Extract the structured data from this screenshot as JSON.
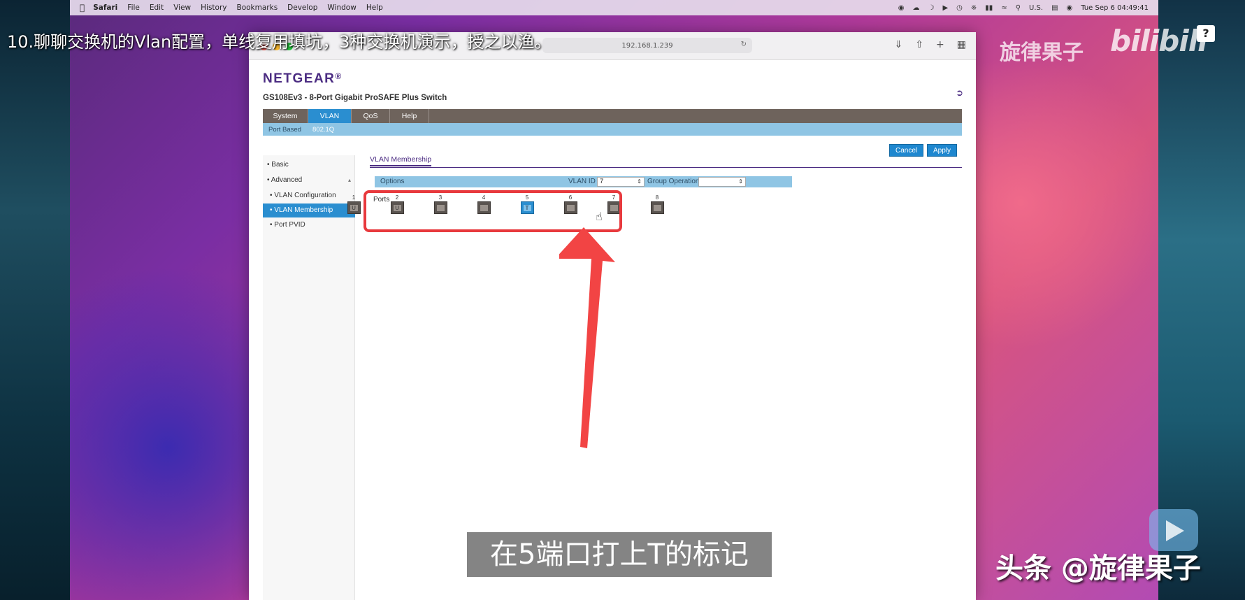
{
  "overlay": {
    "video_title": "10.聊聊交换机的Vlan配置，单线复用填坑，3种交换机演示，授之以渔。",
    "bili_channel": "旋律果子",
    "bili_logo": "bilibili",
    "help_badge": "?",
    "subtitle": "在5端口打上T的标记",
    "watermark": "头条 @旋律果子"
  },
  "menubar": {
    "items": [
      "Safari",
      "File",
      "Edit",
      "View",
      "History",
      "Bookmarks",
      "Develop",
      "Window",
      "Help"
    ],
    "input_source": "U.S.",
    "datetime": "Tue Sep 6  04:49:41"
  },
  "browser": {
    "address": "192.168.1.239"
  },
  "netgear": {
    "logo": "NETGEAR",
    "model": "GS108Ev3 - 8-Port Gigabit ProSAFE Plus Switch",
    "tabs": [
      "System",
      "VLAN",
      "QoS",
      "Help"
    ],
    "active_tab": "VLAN",
    "subtabs": [
      "Port Based",
      "802.1Q"
    ],
    "active_subtab": "802.1Q",
    "buttons": {
      "cancel": "Cancel",
      "apply": "Apply"
    },
    "sidebar": {
      "basic": "Basic",
      "advanced": "Advanced",
      "vlan_configuration": "VLAN Configuration",
      "vlan_membership": "VLAN Membership",
      "port_pvid": "Port PVID"
    },
    "content_title": "VLAN Membership",
    "options_label": "Options",
    "vlan_id_label": "VLAN ID",
    "vlan_id_value": "7",
    "group_operation_label": "Group Operation",
    "group_operation_value": "",
    "ports_label": "Ports",
    "ports": [
      {
        "num": "1",
        "state": "U"
      },
      {
        "num": "2",
        "state": "U"
      },
      {
        "num": "3",
        "state": ""
      },
      {
        "num": "4",
        "state": ""
      },
      {
        "num": "5",
        "state": "T"
      },
      {
        "num": "6",
        "state": ""
      },
      {
        "num": "7",
        "state": ""
      },
      {
        "num": "8",
        "state": ""
      }
    ]
  },
  "colors": {
    "netgear_purple": "#4b2c82",
    "active_blue": "#2a8ed0",
    "highlight_red": "#e8393d"
  }
}
